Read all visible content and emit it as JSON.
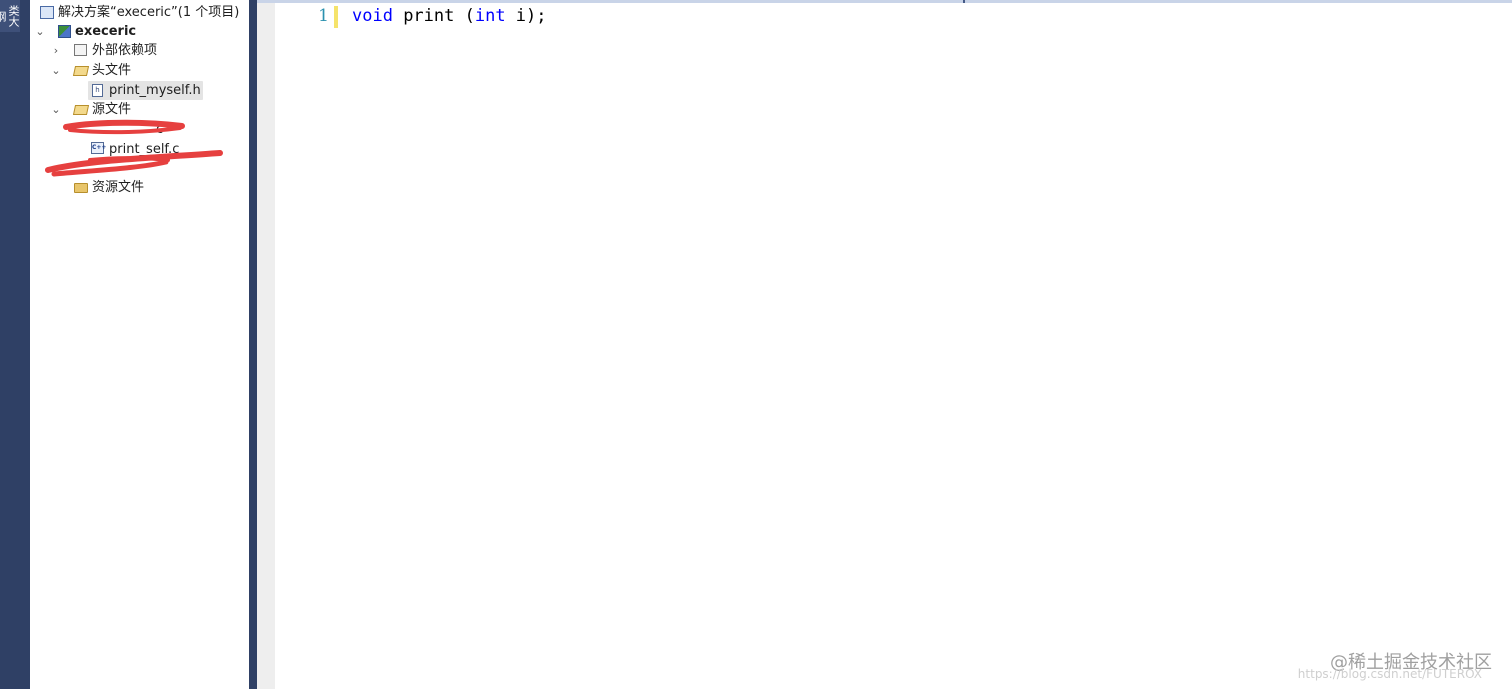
{
  "dock": {
    "tab_label": "类大纲"
  },
  "solution_explorer": {
    "solution": {
      "label": "解决方案“execeric”(1 个项目)",
      "icon": "solution-icon"
    },
    "project": {
      "label": "execeric",
      "icon": "project-icon",
      "expanded": true
    },
    "external_deps": {
      "label": "外部依赖项",
      "icon": "dependencies-icon",
      "expanded": false
    },
    "headers_folder": {
      "label": "头文件",
      "icon": "folder-open-icon",
      "expanded": true
    },
    "header_file": {
      "label": "print_myself.h",
      "icon": "header-file-icon",
      "selected": true
    },
    "sources_folder": {
      "label": "源文件",
      "icon": "folder-open-icon",
      "expanded": true
    },
    "redacted_file_1": {
      "label": "c"
    },
    "source_file": {
      "label": "print_self.c",
      "icon": "cpp-file-icon"
    },
    "resources_folder": {
      "label": "资源文件",
      "icon": "folder-icon"
    }
  },
  "editor": {
    "line_number": "1",
    "code": {
      "kw1": "void",
      "text1": " print (",
      "kw2": "int",
      "text2": " i);"
    },
    "colors": {
      "keyword": "#0000ff",
      "line_number": "#2b91af",
      "change_bar": "#f5e36b"
    }
  },
  "watermark": {
    "text": "@稀土掘金技术社区",
    "url": "https://blog.csdn.net/FUTEROX"
  }
}
